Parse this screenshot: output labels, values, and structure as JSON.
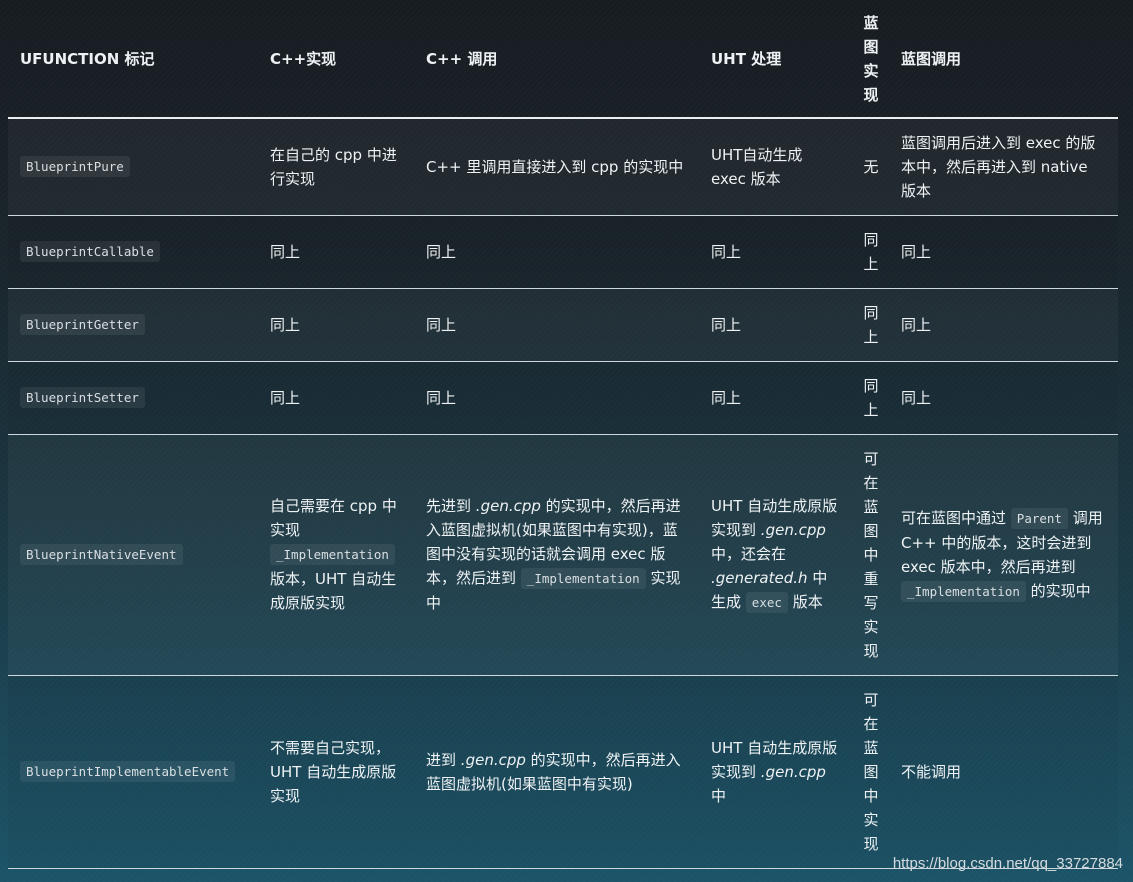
{
  "headers": {
    "h0": "UFUNCTION 标记",
    "h1": "C++实现",
    "h2": "C++ 调用",
    "h3": "UHT 处理",
    "h4": "蓝图实现",
    "h5": "蓝图调用"
  },
  "rows": [
    {
      "tag": "BlueprintPure",
      "cpp_impl": "在自己的 cpp 中进行实现",
      "cpp_call": "C++ 里调用直接进入到 cpp 的实现中",
      "uht": "UHT自动生成 exec 版本",
      "bp_impl": "无",
      "bp_call": "蓝图调用后进入到 exec 的版本中，然后再进入到 native 版本"
    },
    {
      "tag": "BlueprintCallable",
      "cpp_impl": "同上",
      "cpp_call": "同上",
      "uht": "同上",
      "bp_impl": "同上",
      "bp_call": "同上"
    },
    {
      "tag": "BlueprintGetter",
      "cpp_impl": "同上",
      "cpp_call": "同上",
      "uht": "同上",
      "bp_impl": "同上",
      "bp_call": "同上"
    },
    {
      "tag": "BlueprintSetter",
      "cpp_impl": "同上",
      "cpp_call": "同上",
      "uht": "同上",
      "bp_impl": "同上",
      "bp_call": "同上"
    },
    {
      "tag": "BlueprintNativeEvent",
      "cpp_impl_a": "自己需要在 cpp 中实现",
      "cpp_impl_code": "_Implementation",
      "cpp_impl_b": "版本，UHT 自动生成原版实现",
      "cpp_call_a": "先进到",
      "cpp_call_file": ".gen.cpp",
      "cpp_call_b": "的实现中，然后再进入蓝图虚拟机(如果蓝图中有实现)，蓝图中没有实现的话就会调用 exec 版本，然后进到",
      "cpp_call_code": "_Implementation",
      "cpp_call_c": "实现中",
      "uht_a": "UHT 自动生成原版实现到",
      "uht_file1": ".gen.cpp",
      "uht_b": "中，还会在",
      "uht_file2": ".generated.h",
      "uht_c": "中生成",
      "uht_code": "exec",
      "uht_d": "版本",
      "bp_impl": "可在蓝图中重写实现",
      "bp_call_a": "可在蓝图中通过",
      "bp_call_code1": "Parent",
      "bp_call_b": "调用 C++ 中的版本，这时会进到 exec 版本中，然后再进到",
      "bp_call_code2": "_Implementation",
      "bp_call_c": "的实现中"
    },
    {
      "tag": "BlueprintImplementableEvent",
      "cpp_impl": "不需要自己实现，UHT 自动生成原版实现",
      "cpp_call_a": "进到",
      "cpp_call_file": ".gen.cpp",
      "cpp_call_b": "的实现中，然后再进入蓝图虚拟机(如果蓝图中有实现)",
      "uht_a": "UHT 自动生成原版实现到",
      "uht_file": ".gen.cpp",
      "uht_b": "中",
      "bp_impl": "可在蓝图中实现",
      "bp_call": "不能调用"
    }
  ],
  "watermark": "https://blog.csdn.net/qq_33727884"
}
